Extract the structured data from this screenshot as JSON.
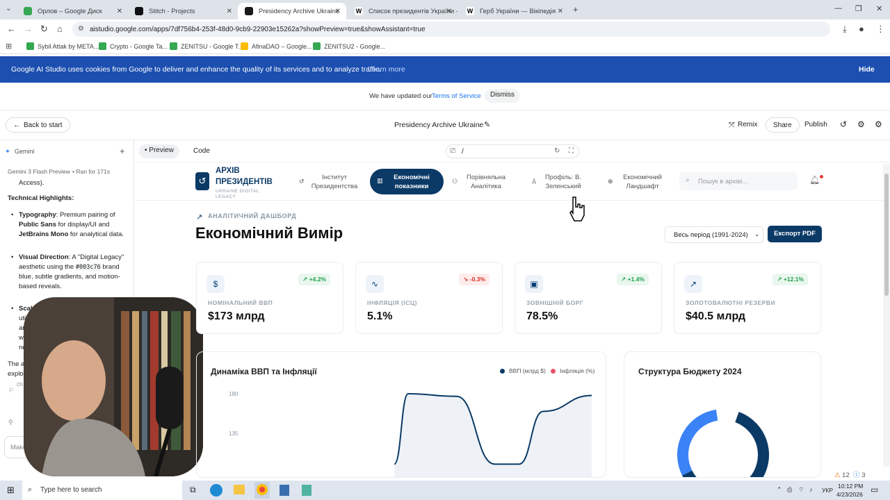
{
  "browser": {
    "tabs": [
      {
        "title": "Орлов – Google Диск",
        "active": false
      },
      {
        "title": "Stitch - Projects",
        "active": false
      },
      {
        "title": "Presidency Archive Ukraine | G",
        "active": true
      },
      {
        "title": "Список президентів України –",
        "active": false
      },
      {
        "title": "Герб України — Вікіпедія",
        "active": false
      }
    ],
    "url": "aistudio.google.com/apps/7df756b4-253f-48d0-9cb9-22903e15262a?showPreview=true&showAssistant=true",
    "bookmarks": [
      "Sybil Attak by META...",
      "Crypto - Google Ta...",
      "ZENITSU - Google T...",
      "AfinaDAO – Google...",
      "ZENITSU2 - Google..."
    ]
  },
  "cookie_banner": {
    "text": "Google AI Studio uses cookies from Google to deliver and enhance the quality of its services and to analyze traffic.",
    "learn_more": "Learn more",
    "hide": "Hide"
  },
  "terms_notice": {
    "text": "We have updated our",
    "link": "Terms of Service",
    "dismiss": "Dismiss"
  },
  "studio_header": {
    "back": "Back to start",
    "project_title": "Presidency Archive Ukraine",
    "remix": "Remix",
    "share": "Share",
    "publish": "Publish"
  },
  "left_panel": {
    "title": "Gemini",
    "meta_model": "Gemini 3 Flash Preview",
    "meta_ran": "Ran for 171s",
    "access": "Access).",
    "highlights_title": "Technical Highlights:",
    "typography_label": "Typography",
    "typography_text_1": ": Premium pairing of",
    "typography_public": "Public Sans",
    "typography_text_2": " for display/UI and",
    "typography_jet": "JetBrains Mono",
    "typography_text_3": " for analytical data.",
    "visual_label": "Visual Direction",
    "visual_text_1": ": A \"Digital Legacy\" aesthetic using the",
    "visual_code": "#003c76",
    "visual_text_2": " brand blue, subtle gradients, and motion-based reveals.",
    "scalable_label": "Scalabl",
    "partial_1": "utilit",
    "partial_2": "arc",
    "partial_3": "wi",
    "partial_4": "ne",
    "partial_5": "The a",
    "partial_6": "explo",
    "partial_7": "Ch",
    "input_placeholder": "Make"
  },
  "preview_bar": {
    "preview": "Preview",
    "code": "Code",
    "path": "/"
  },
  "app": {
    "logo_line1": "АРХІВ",
    "logo_line2": "ПРЕЗИДЕНТІВ",
    "logo_sub1": "UKRAINE DIGITAL",
    "logo_sub2": "LEGACY",
    "nav": [
      {
        "line1": "Інститут",
        "line2": "Президентства",
        "icon": "history-icon"
      },
      {
        "line1": "Економічні",
        "line2": "показники",
        "icon": "bar-chart-icon"
      },
      {
        "line1": "Порівняльна",
        "line2": "Аналітика",
        "icon": "people-icon"
      },
      {
        "line1": "Профіль: В.",
        "line2": "Зеленський",
        "icon": "person-icon"
      },
      {
        "line1": "Економічний",
        "line2": "Ландшафт",
        "icon": "globe-icon"
      }
    ],
    "search_placeholder": "Пошук в архіві...",
    "section_label": "АНАЛІТИЧНИЙ ДАШБОРД",
    "page_title": "Економічний Вимір",
    "period_select": "Весь період (1991-2024)",
    "export_button": "Експорт PDF",
    "accent_color": "#003c76",
    "kpis": [
      {
        "icon": "$",
        "change": "+4.2%",
        "direction": "up",
        "label": "НОМІНАЛЬНИЙ ВВП",
        "value": "$173 млрд"
      },
      {
        "icon": "∿",
        "change": "-0.3%",
        "direction": "down",
        "label": "ІНФЛЯЦІЯ (ІСЦ)",
        "value": "5.1%"
      },
      {
        "icon": "▣",
        "change": "+1.4%",
        "direction": "up",
        "label": "ЗОВНІШНІЙ БОРГ",
        "value": "78.5%"
      },
      {
        "icon": "↗",
        "change": "+12.1%",
        "direction": "up",
        "label": "ЗОЛОТОВАЛЮТНІ РЕЗЕРВИ",
        "value": "$40.5 млрд"
      }
    ],
    "gdp_card_title": "Динаміка ВВП та Інфляції",
    "legend_gdp": "ВВП (млрд $)",
    "legend_inflation": "Інфляція (%)",
    "budget_card_title": "Структура Бюджету 2024"
  },
  "chart_data": [
    {
      "type": "area",
      "title": "Динаміка ВВП та Інфляції",
      "y_ticks": [
        "180",
        "135"
      ],
      "series": [
        {
          "name": "ВВП (млрд $)",
          "color": "#0b3a66",
          "points": [
            [
              0.43,
              100
            ],
            [
              0.47,
              180
            ],
            [
              0.61,
              177
            ],
            [
              0.72,
              100
            ],
            [
              0.79,
              100
            ],
            [
              0.86,
              160
            ],
            [
              1.0,
              178
            ]
          ]
        }
      ],
      "legend_colors": {
        "gdp": "#0b3a66",
        "inflation": "#e8546e"
      }
    },
    {
      "type": "pie",
      "title": "Структура Бюджету 2024",
      "segments": [
        {
          "value": 62,
          "color": "#0b3a66"
        },
        {
          "value": 30,
          "color": "#3b82f6"
        },
        {
          "value": 8,
          "color": "#ffffff"
        }
      ]
    }
  ],
  "taskbar": {
    "search_placeholder": "Type here to search",
    "time": "10:12 PM",
    "date": "4/23/2026",
    "lang": "УКР"
  },
  "status": {
    "warnings": "12",
    "info": "3"
  }
}
